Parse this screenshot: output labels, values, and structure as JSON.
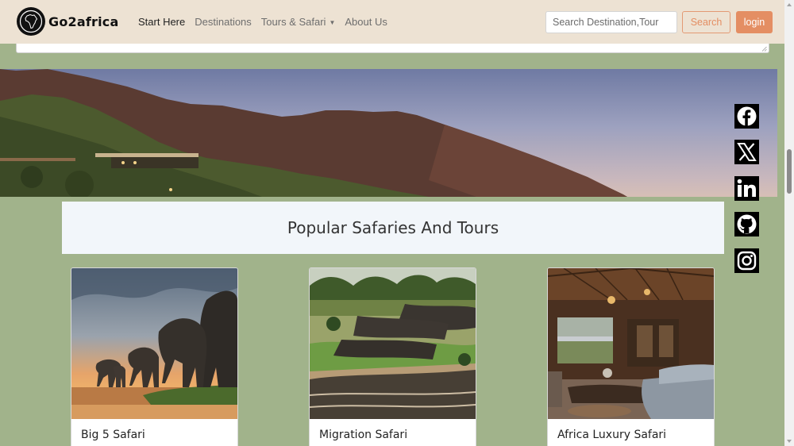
{
  "brand": {
    "name": "Go2africa",
    "logo_icon": "africa-map-icon"
  },
  "nav": {
    "items": [
      {
        "label": "Start Here",
        "active": true
      },
      {
        "label": "Destinations",
        "active": false
      },
      {
        "label": "Tours & Safari",
        "active": false,
        "dropdown": true
      },
      {
        "label": "About Us",
        "active": false
      }
    ]
  },
  "search": {
    "placeholder": "Search Destination,Tour",
    "button_label": "Search"
  },
  "auth": {
    "login_label": "login"
  },
  "section": {
    "title": "Popular Safaries And Tours"
  },
  "social": [
    {
      "name": "facebook-icon"
    },
    {
      "name": "x-icon"
    },
    {
      "name": "linkedin-icon"
    },
    {
      "name": "github-icon"
    },
    {
      "name": "instagram-icon"
    }
  ],
  "cards": [
    {
      "title": "Big 5 Safari"
    },
    {
      "title": "Migration Safari"
    },
    {
      "title": "Africa Luxury Safari"
    }
  ],
  "colors": {
    "page_bg": "#a1b38b",
    "navbar_bg": "#ede2d3",
    "accent": "#e48e63"
  }
}
